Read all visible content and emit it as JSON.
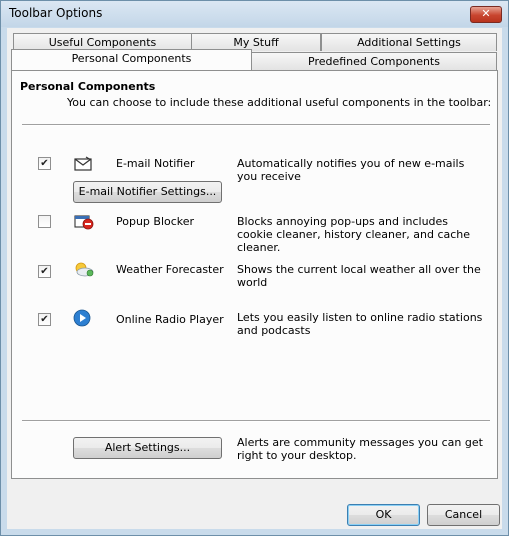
{
  "window": {
    "title": "Toolbar Options",
    "close_symbol": "✕"
  },
  "tabs": {
    "row_back": [
      "Useful Components",
      "My Stuff",
      "Additional Settings"
    ],
    "row_front": [
      "Personal Components",
      "Predefined Components"
    ],
    "active": "Personal Components"
  },
  "section": {
    "title": "Personal Components",
    "description": "You can choose to include these additional useful components in the toolbar:"
  },
  "components": [
    {
      "name": "E-mail Notifier",
      "description": "Automatically notifies you of new e-mails you receive",
      "checked": true,
      "icon": "envelope-icon",
      "settings_button": "E-mail Notifier Settings..."
    },
    {
      "name": "Popup Blocker",
      "description": "Blocks annoying pop-ups and includes cookie cleaner, history cleaner, and cache cleaner.",
      "checked": false,
      "icon": "popup-blocker-icon"
    },
    {
      "name": "Weather Forecaster",
      "description": "Shows the current local weather all over the world",
      "checked": true,
      "icon": "weather-icon"
    },
    {
      "name": "Online Radio Player",
      "description": "Lets you easily listen to online radio stations and podcasts",
      "checked": true,
      "icon": "play-icon"
    }
  ],
  "alerts": {
    "button_label": "Alert Settings...",
    "description": "Alerts are community messages you can get right to your desktop."
  },
  "footer": {
    "ok_label": "OK",
    "cancel_label": "Cancel"
  },
  "check_glyph": "✔"
}
